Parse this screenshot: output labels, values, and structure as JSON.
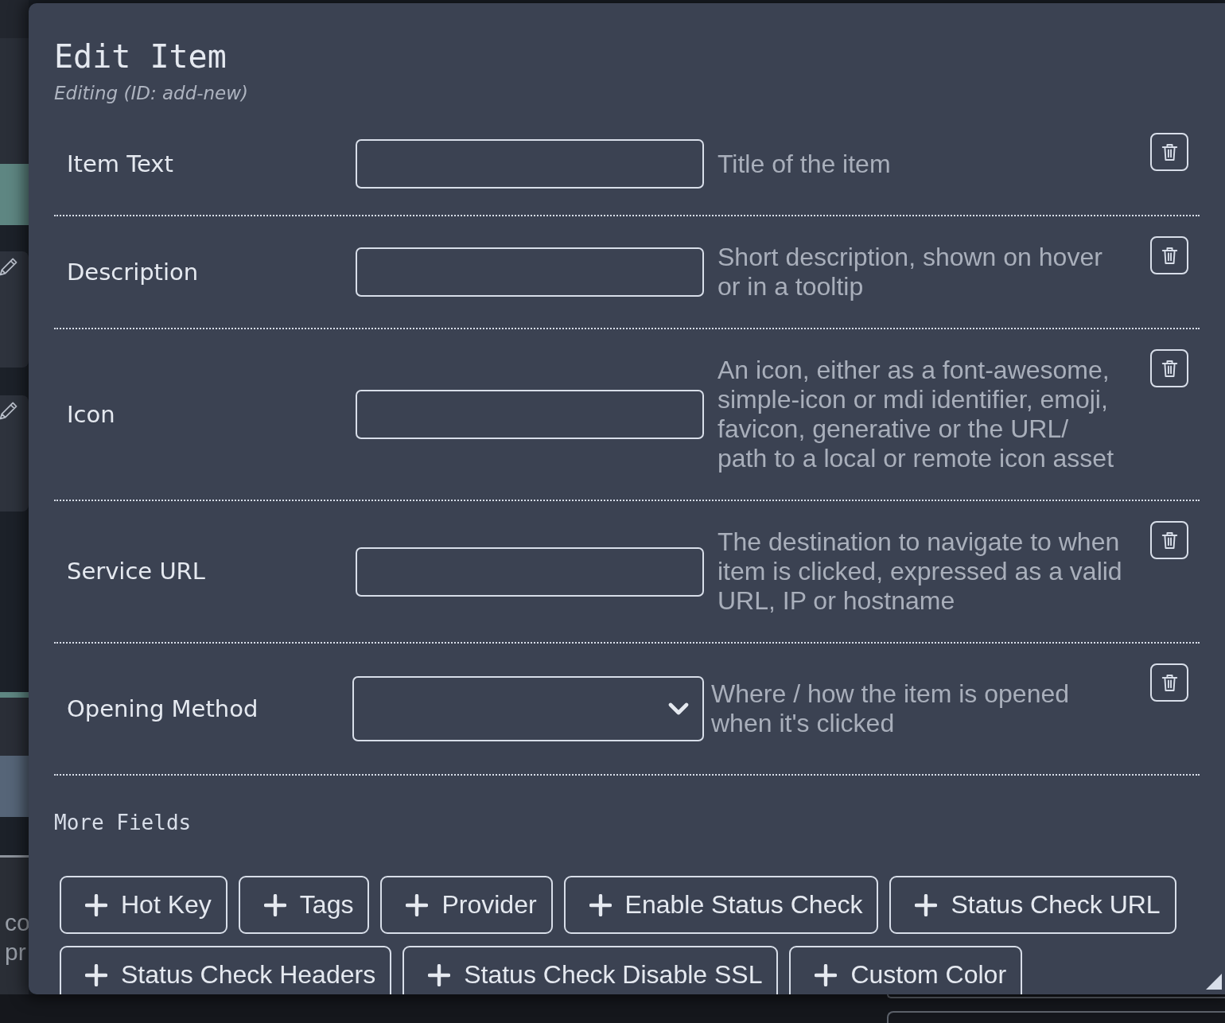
{
  "background": {
    "texts": [
      "co",
      "pr"
    ]
  },
  "dialog": {
    "title": "Edit Item",
    "subtitle": "Editing (ID: add-new)"
  },
  "fields": [
    {
      "label": "Item Text",
      "kind": "input",
      "hint": "Title of the item"
    },
    {
      "label": "Description",
      "kind": "input",
      "hint": "Short description, shown on hover or in a tooltip"
    },
    {
      "label": "Icon",
      "kind": "input",
      "hint": "An icon, either as a font-awesome, simple-icon or mdi identifier, emoji, favicon, generative or the URL/ path to a local or remote icon asset"
    },
    {
      "label": "Service URL",
      "kind": "input",
      "hint": "The destination to navigate to when item is clicked, expressed as a valid URL, IP or hostname"
    },
    {
      "label": "Opening Method",
      "kind": "select",
      "hint": "Where / how the item is opened when it's clicked"
    }
  ],
  "more_fields": {
    "heading": "More Fields",
    "buttons": [
      "Hot Key",
      "Tags",
      "Provider",
      "Enable Status Check",
      "Status Check URL",
      "Status Check Headers",
      "Status Check Disable SSL",
      "Custom Color"
    ]
  }
}
